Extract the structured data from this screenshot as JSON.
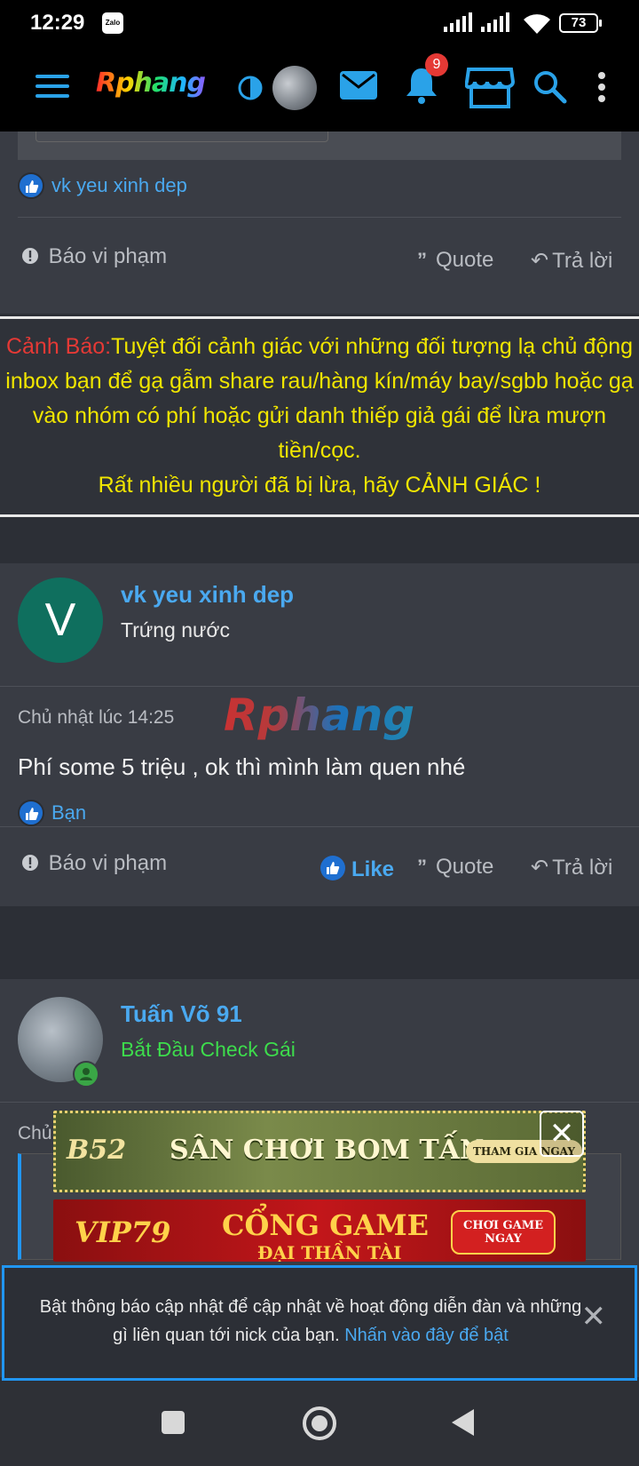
{
  "status_bar": {
    "time": "12:29",
    "notif_app": "Zalo",
    "battery": "73"
  },
  "app_bar": {
    "logo": "Rphang",
    "notifications_count": "9"
  },
  "post_prev": {
    "liker": "vk yeu xinh dep",
    "report": "Báo vi phạm",
    "quote": "Quote",
    "reply": "Trả lời"
  },
  "warning": {
    "label": "Cảnh Báo:",
    "text": "Tuyệt đối cảnh giác với những đối tượng lạ chủ động inbox bạn để gạ gẫm share rau/hàng kín/máy bay/sgbb hoặc gạ vào nhóm có phí hoặc gửi danh thiếp giả gái để lừa mượn tiền/cọc.",
    "line2": "Rất nhiều người đã bị lừa, hãy CẢNH GIÁC !"
  },
  "post": {
    "avatar_letter": "V",
    "username": "vk yeu xinh dep",
    "user_title": "Trứng nước",
    "time": "Chủ nhật lúc 14:25",
    "watermark": "Rphang",
    "body": "Phí some 5 triệu , ok thì mình làm quen nhé",
    "liker": "Bạn",
    "report": "Báo vi phạm",
    "like": "Like",
    "quote": "Quote",
    "reply": "Trả lời"
  },
  "post_next": {
    "username": "Tuấn Võ 91",
    "user_title": "Bắt Đầu Check Gái",
    "time_partial": "Chủ"
  },
  "ads": {
    "ad1_brand": "B52",
    "ad1_text": "SÂN CHƠI BOM TẤN",
    "ad1_cta": "THAM GIA NGAY",
    "ad2_brand": "VIP79",
    "ad2_text": "CỔNG GAME",
    "ad2_sub": "ĐẠI THẦN TÀI",
    "ad2_cta": "CHƠI GAME NGAY",
    "close": "✕"
  },
  "notice": {
    "text": "Bật thông báo cập nhật để cập nhật về hoạt động diễn đàn và những gì liên quan tới nick của bạn.",
    "link": "Nhấn vào đây để bật",
    "close": "✕"
  },
  "colors": {
    "accent": "#4aa9f0",
    "warning_yellow": "#f0e500",
    "warning_red": "#e53935",
    "user_title_green": "#3ddc4c"
  }
}
